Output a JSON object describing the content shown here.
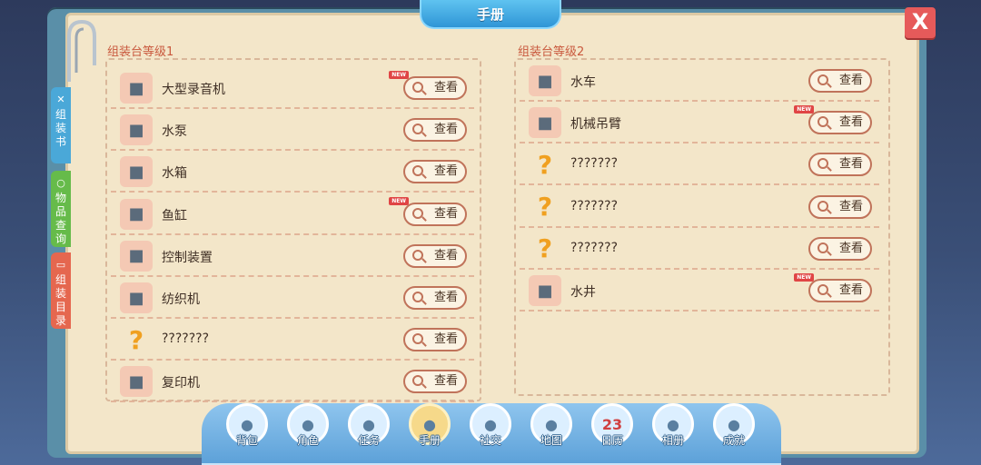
{
  "header": {
    "title": "手册"
  },
  "close_label": "X",
  "side_tabs": [
    {
      "label": "组装书",
      "icon": "wrench-icon",
      "color": "#4aa8d8"
    },
    {
      "label": "物品查询",
      "icon": "search-icon",
      "color": "#66bb4a"
    },
    {
      "label": "组装目录",
      "icon": "book-icon",
      "color": "#e5674f"
    }
  ],
  "panel1": {
    "title": "组装台等级1",
    "items": [
      {
        "name": "大型录音机",
        "new": true,
        "button": "查看",
        "icon": "recorder-icon"
      },
      {
        "name": "水泵",
        "new": false,
        "button": "查看",
        "icon": "pump-icon"
      },
      {
        "name": "水箱",
        "new": false,
        "button": "查看",
        "icon": "tank-icon"
      },
      {
        "name": "鱼缸",
        "new": true,
        "button": "查看",
        "icon": "aquarium-icon"
      },
      {
        "name": "控制装置",
        "new": false,
        "button": "查看",
        "icon": "control-icon"
      },
      {
        "name": "纺织机",
        "new": false,
        "button": "查看",
        "icon": "loom-icon"
      },
      {
        "name": "???????",
        "new": false,
        "button": "查看",
        "icon": "question-icon"
      },
      {
        "name": "复印机",
        "new": false,
        "button": "查看",
        "icon": "copier-icon"
      }
    ]
  },
  "panel2": {
    "title": "组装台等级2",
    "items": [
      {
        "name": "水车",
        "new": false,
        "button": "查看",
        "icon": "waterwheel-icon"
      },
      {
        "name": "机械吊臂",
        "new": true,
        "button": "查看",
        "icon": "crane-icon"
      },
      {
        "name": "???????",
        "new": false,
        "button": "查看",
        "icon": "question-icon"
      },
      {
        "name": "???????",
        "new": false,
        "button": "查看",
        "icon": "question-icon"
      },
      {
        "name": "???????",
        "new": false,
        "button": "查看",
        "icon": "question-icon"
      },
      {
        "name": "水井",
        "new": true,
        "button": "查看",
        "icon": "well-icon"
      }
    ]
  },
  "new_badge": "NEW",
  "dock": [
    {
      "label": "背包",
      "icon": "backpack-icon",
      "active": false
    },
    {
      "label": "角色",
      "icon": "character-icon",
      "active": false
    },
    {
      "label": "任务",
      "icon": "task-icon",
      "active": false
    },
    {
      "label": "手册",
      "icon": "hammer-icon",
      "active": true
    },
    {
      "label": "社交",
      "icon": "handshake-icon",
      "active": false
    },
    {
      "label": "地图",
      "icon": "map-icon",
      "active": false
    },
    {
      "label": "日历",
      "icon": "calendar-icon",
      "active": false
    },
    {
      "label": "相册",
      "icon": "album-icon",
      "active": false
    },
    {
      "label": "成就",
      "icon": "trophy-icon",
      "active": false
    }
  ],
  "calendar_day": "23",
  "colors": {
    "accent": "#c9593e",
    "title_bar": "#2f95d6",
    "page": "#f3e6c9"
  }
}
